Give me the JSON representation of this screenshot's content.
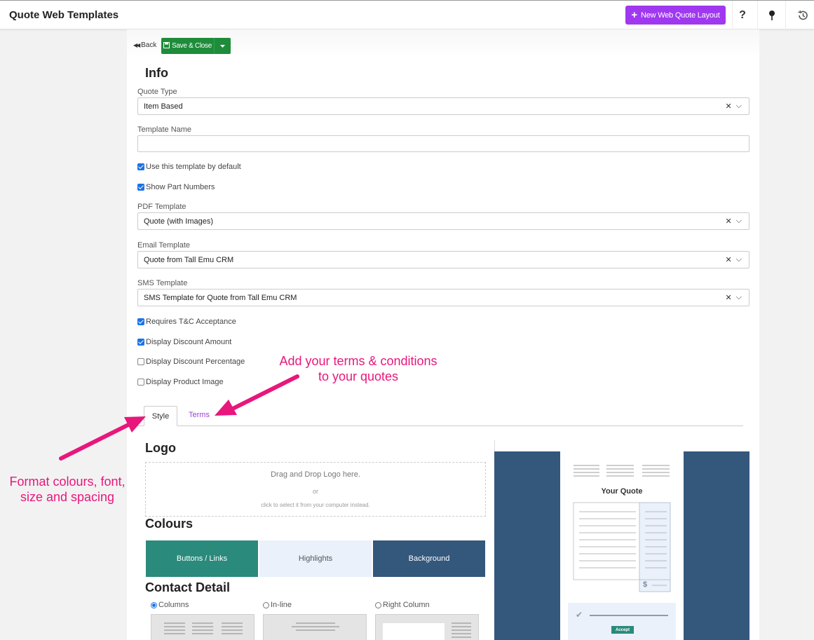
{
  "header": {
    "title": "Quote Web Templates",
    "new_button": "New Web Quote Layout",
    "help_icon": "?"
  },
  "toolbar": {
    "back": "Back",
    "save_close": "Save & Close"
  },
  "info": {
    "title": "Info",
    "quote_type": {
      "label": "Quote Type",
      "value": "Item Based"
    },
    "template_name": {
      "label": "Template Name",
      "value": ""
    },
    "use_default": {
      "label": "Use this template by default",
      "checked": true
    },
    "show_part_numbers": {
      "label": "Show Part Numbers",
      "checked": true
    },
    "pdf_template": {
      "label": "PDF Template",
      "value": "Quote (with Images)"
    },
    "email_template": {
      "label": "Email Template",
      "value": "Quote from Tall Emu CRM"
    },
    "sms_template": {
      "label": "SMS Template",
      "value": "SMS Template for Quote from Tall Emu CRM"
    },
    "requires_tc": {
      "label": "Requires T&C Acceptance",
      "checked": true
    },
    "display_discount_amount": {
      "label": "Display Discount Amount",
      "checked": true
    },
    "display_discount_percentage": {
      "label": "Display Discount Percentage",
      "checked": false
    },
    "display_product_image": {
      "label": "Display Product Image",
      "checked": false
    }
  },
  "tabs": [
    {
      "label": "Style",
      "active": true
    },
    {
      "label": "Terms",
      "active": false
    }
  ],
  "style": {
    "logo": {
      "title": "Logo",
      "drop_text": "Drag and Drop Logo here.",
      "or_text": "or",
      "click_text": "click to select it from your computer instead."
    },
    "colours": {
      "title": "Colours",
      "items": [
        {
          "label": "Buttons / Links",
          "bg": "#2a8a7c",
          "fg": "#ffffff"
        },
        {
          "label": "Highlights",
          "bg": "#eaf1fb",
          "fg": "#555555"
        },
        {
          "label": "Background",
          "bg": "#34577c",
          "fg": "#ffffff"
        }
      ]
    },
    "contact_detail": {
      "title": "Contact Detail",
      "options": [
        {
          "label": "Columns",
          "selected": true
        },
        {
          "label": "In-line",
          "selected": false
        },
        {
          "label": "Right Column",
          "selected": false
        }
      ]
    }
  },
  "preview": {
    "heading": "Your Quote",
    "currency_symbol": "$",
    "accept_label": "Accept"
  },
  "annotations": {
    "terms_note": [
      "Add your terms & conditions",
      "to your quotes"
    ],
    "style_note": [
      "Format colours, font,",
      "size and spacing"
    ]
  },
  "colors": {
    "accent_purple": "#a038f0",
    "save_green": "#1e8c3a",
    "annotation_pink": "#e8177c",
    "checkbox_blue": "#1a73e8"
  }
}
